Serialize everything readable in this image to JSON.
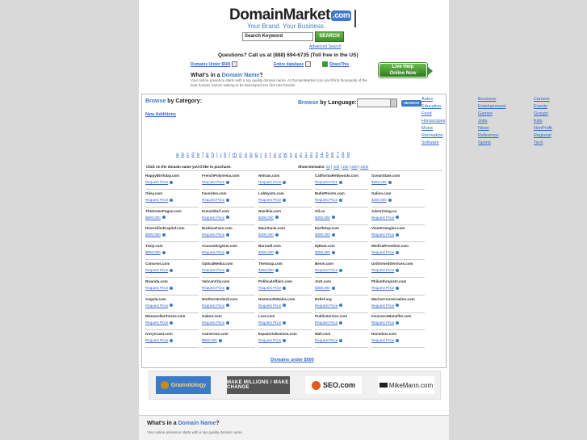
{
  "header": {
    "logo_main": "DomainMarket",
    "logo_com": ".com",
    "tagline": "Your Brand. Your Business.",
    "search_placeholder": "Search Keyword",
    "search_button": "SEARCH",
    "advanced_search": "Advanced Search",
    "questions": "Questions? Call us at (888) 694-6735 (Toll free in the US)",
    "link_under_500": "Domains Under $500",
    "link_entire_db": "Entire database",
    "link_share": "ShareThis",
    "live_help_line1": "Live Help",
    "live_help_line2": "Online Now"
  },
  "intro": {
    "title_prefix": "What's in a ",
    "title_highlight": "Domain Name",
    "title_suffix": "?",
    "text": "Your online presence starts with a top quality domain name. At DomainMarket.com you'll find thousands of the best domain names waiting to be developed into first rate brands."
  },
  "browse": {
    "category_prefix": "Browse",
    "category_suffix": " by Category:",
    "new_additions": "New Additions",
    "language_prefix": "Browse",
    "language_suffix": " by Language:",
    "language_button": "SEARCH",
    "categories_col1": [
      "Autos",
      "Education",
      "Food",
      "Horoscopes",
      "Music",
      "Recreation",
      "Software"
    ],
    "categories_col2": [
      "Business",
      "Entertainment",
      "Games",
      "Jobs",
      "News",
      "Reference",
      "Sports"
    ],
    "categories_col3": [
      "Careers",
      "Events",
      "Groups",
      "Kids",
      "NonProfit",
      "Regional",
      "Tech"
    ]
  },
  "alphabet": [
    "a",
    "b",
    "c",
    "d",
    "e",
    "f",
    "g",
    "h",
    "i",
    "j",
    "k",
    "l",
    "m",
    "n",
    "o",
    "p",
    "q",
    "r",
    "s",
    "t",
    "u",
    "v",
    "w",
    "x",
    "y",
    "z",
    "1",
    "2",
    "3",
    "4",
    "5",
    "6",
    "7",
    "8",
    "9"
  ],
  "listing": {
    "click_note": "Click on the domain name you'd like to purchase.",
    "show_label": "Show Domains:",
    "show_options": [
      "50",
      "100",
      "150",
      "300",
      "1000"
    ],
    "under_500": "Domains under $500",
    "rows": [
      [
        {
          "name": "HappyBirthday.com",
          "price": "Request Price"
        },
        {
          "name": "FrenchPolynesia.com",
          "price": "Request Price"
        },
        {
          "name": "NetGas.com",
          "price": "Request Price"
        },
        {
          "name": "CaliforniaRedwoods.com",
          "price": "Request Price"
        },
        {
          "name": "OceanState.com",
          "price": "$250,000"
        }
      ],
      [
        {
          "name": "Oliey.com",
          "price": "Request Price"
        },
        {
          "name": "Favorites.com",
          "price": "Request Price"
        },
        {
          "name": "Lobbyists.com",
          "price": "Request Price"
        },
        {
          "name": "BulletPoints.com",
          "price": "Request Price"
        },
        {
          "name": "Galion.com",
          "price": "$250,000"
        }
      ],
      [
        {
          "name": "TheGreenPages.com",
          "price": "$800,000"
        },
        {
          "name": "Dusseldorf.com",
          "price": "Request Price"
        },
        {
          "name": "Namibia.com",
          "price": "$400,000"
        },
        {
          "name": "Oil.co",
          "price": "$300,000"
        },
        {
          "name": "Advertising.co",
          "price": "Request Price"
        }
      ],
      [
        {
          "name": "DiversifiedCapital.com",
          "price": "$800,000"
        },
        {
          "name": "BurkinaFaso.com",
          "price": "Request Price"
        },
        {
          "name": "Mauritania.com",
          "price": "$400,000"
        },
        {
          "name": "EarthDay.com",
          "price": "$350,000"
        },
        {
          "name": "VisaStrategies.com",
          "price": "Request Price"
        }
      ],
      [
        {
          "name": "Tasty.com",
          "price": "$800,000"
        },
        {
          "name": "AccountingOne.com",
          "price": "Request Price"
        },
        {
          "name": "Burundi.com",
          "price": "$400,000"
        },
        {
          "name": "DjBeat.com",
          "price": "$350,000"
        },
        {
          "name": "MedicalFreedom.com",
          "price": "Request Price"
        }
      ],
      [
        {
          "name": "Comoros.com",
          "price": "Request Price"
        },
        {
          "name": "OpticalMedia.com",
          "price": "Request Price"
        },
        {
          "name": "TheSoup.com",
          "price": "$350,000"
        },
        {
          "name": "Benin.com",
          "price": "Request Price"
        },
        {
          "name": "UniformedServices.com",
          "price": "Request Price"
        }
      ],
      [
        {
          "name": "Rwanda.com",
          "price": "Request Price"
        },
        {
          "name": "VaticanCity.com",
          "price": "Request Price"
        },
        {
          "name": "PoliticalAffairs.com",
          "price": "Request Price"
        },
        {
          "name": "AUX.com",
          "price": "$300,000"
        },
        {
          "name": "Philanthropists.com",
          "price": "Request Price"
        }
      ],
      [
        {
          "name": "Angola.com",
          "price": "Request Price"
        },
        {
          "name": "NorthernIreland.com",
          "price": "Request Price"
        },
        {
          "name": "NewSouthWales.com",
          "price": "Request Price"
        },
        {
          "name": "Relief.org",
          "price": "Request Price"
        },
        {
          "name": "MarineConservation.com",
          "price": "Request Price"
        }
      ],
      [
        {
          "name": "MozzarellaCheese.com",
          "price": "Request Price"
        },
        {
          "name": "Gabon.com",
          "price": "Request Price"
        },
        {
          "name": "Lure.com",
          "price": "Request Price"
        },
        {
          "name": "PublicService.com",
          "price": "Request Price"
        },
        {
          "name": "InsuranceBenefits.com",
          "price": "Request Price"
        }
      ],
      [
        {
          "name": "IvoryCoast.com",
          "price": "Request Price"
        },
        {
          "name": "Cameroon.com",
          "price": "$500,000"
        },
        {
          "name": "EquatorialGuinea.com",
          "price": "Request Price"
        },
        {
          "name": "Mali.com",
          "price": "Request Price"
        },
        {
          "name": "Homebox.com",
          "price": "Request Price"
        }
      ]
    ]
  },
  "banners": {
    "b1": "Gramotology",
    "b2": "MAKE MILLIONS / MAKE CHANGE",
    "b3": "SEO.com",
    "b4": "MikeMann.com"
  },
  "footer_intro": {
    "title_prefix": "What's in a ",
    "title_highlight": "Domain Name",
    "title_suffix": "?",
    "text": "Your online presence starts with a top quality domain name."
  },
  "colors": {
    "accent": "#3b7ac9",
    "green": "#3f8e2a",
    "link": "#3366cc"
  }
}
